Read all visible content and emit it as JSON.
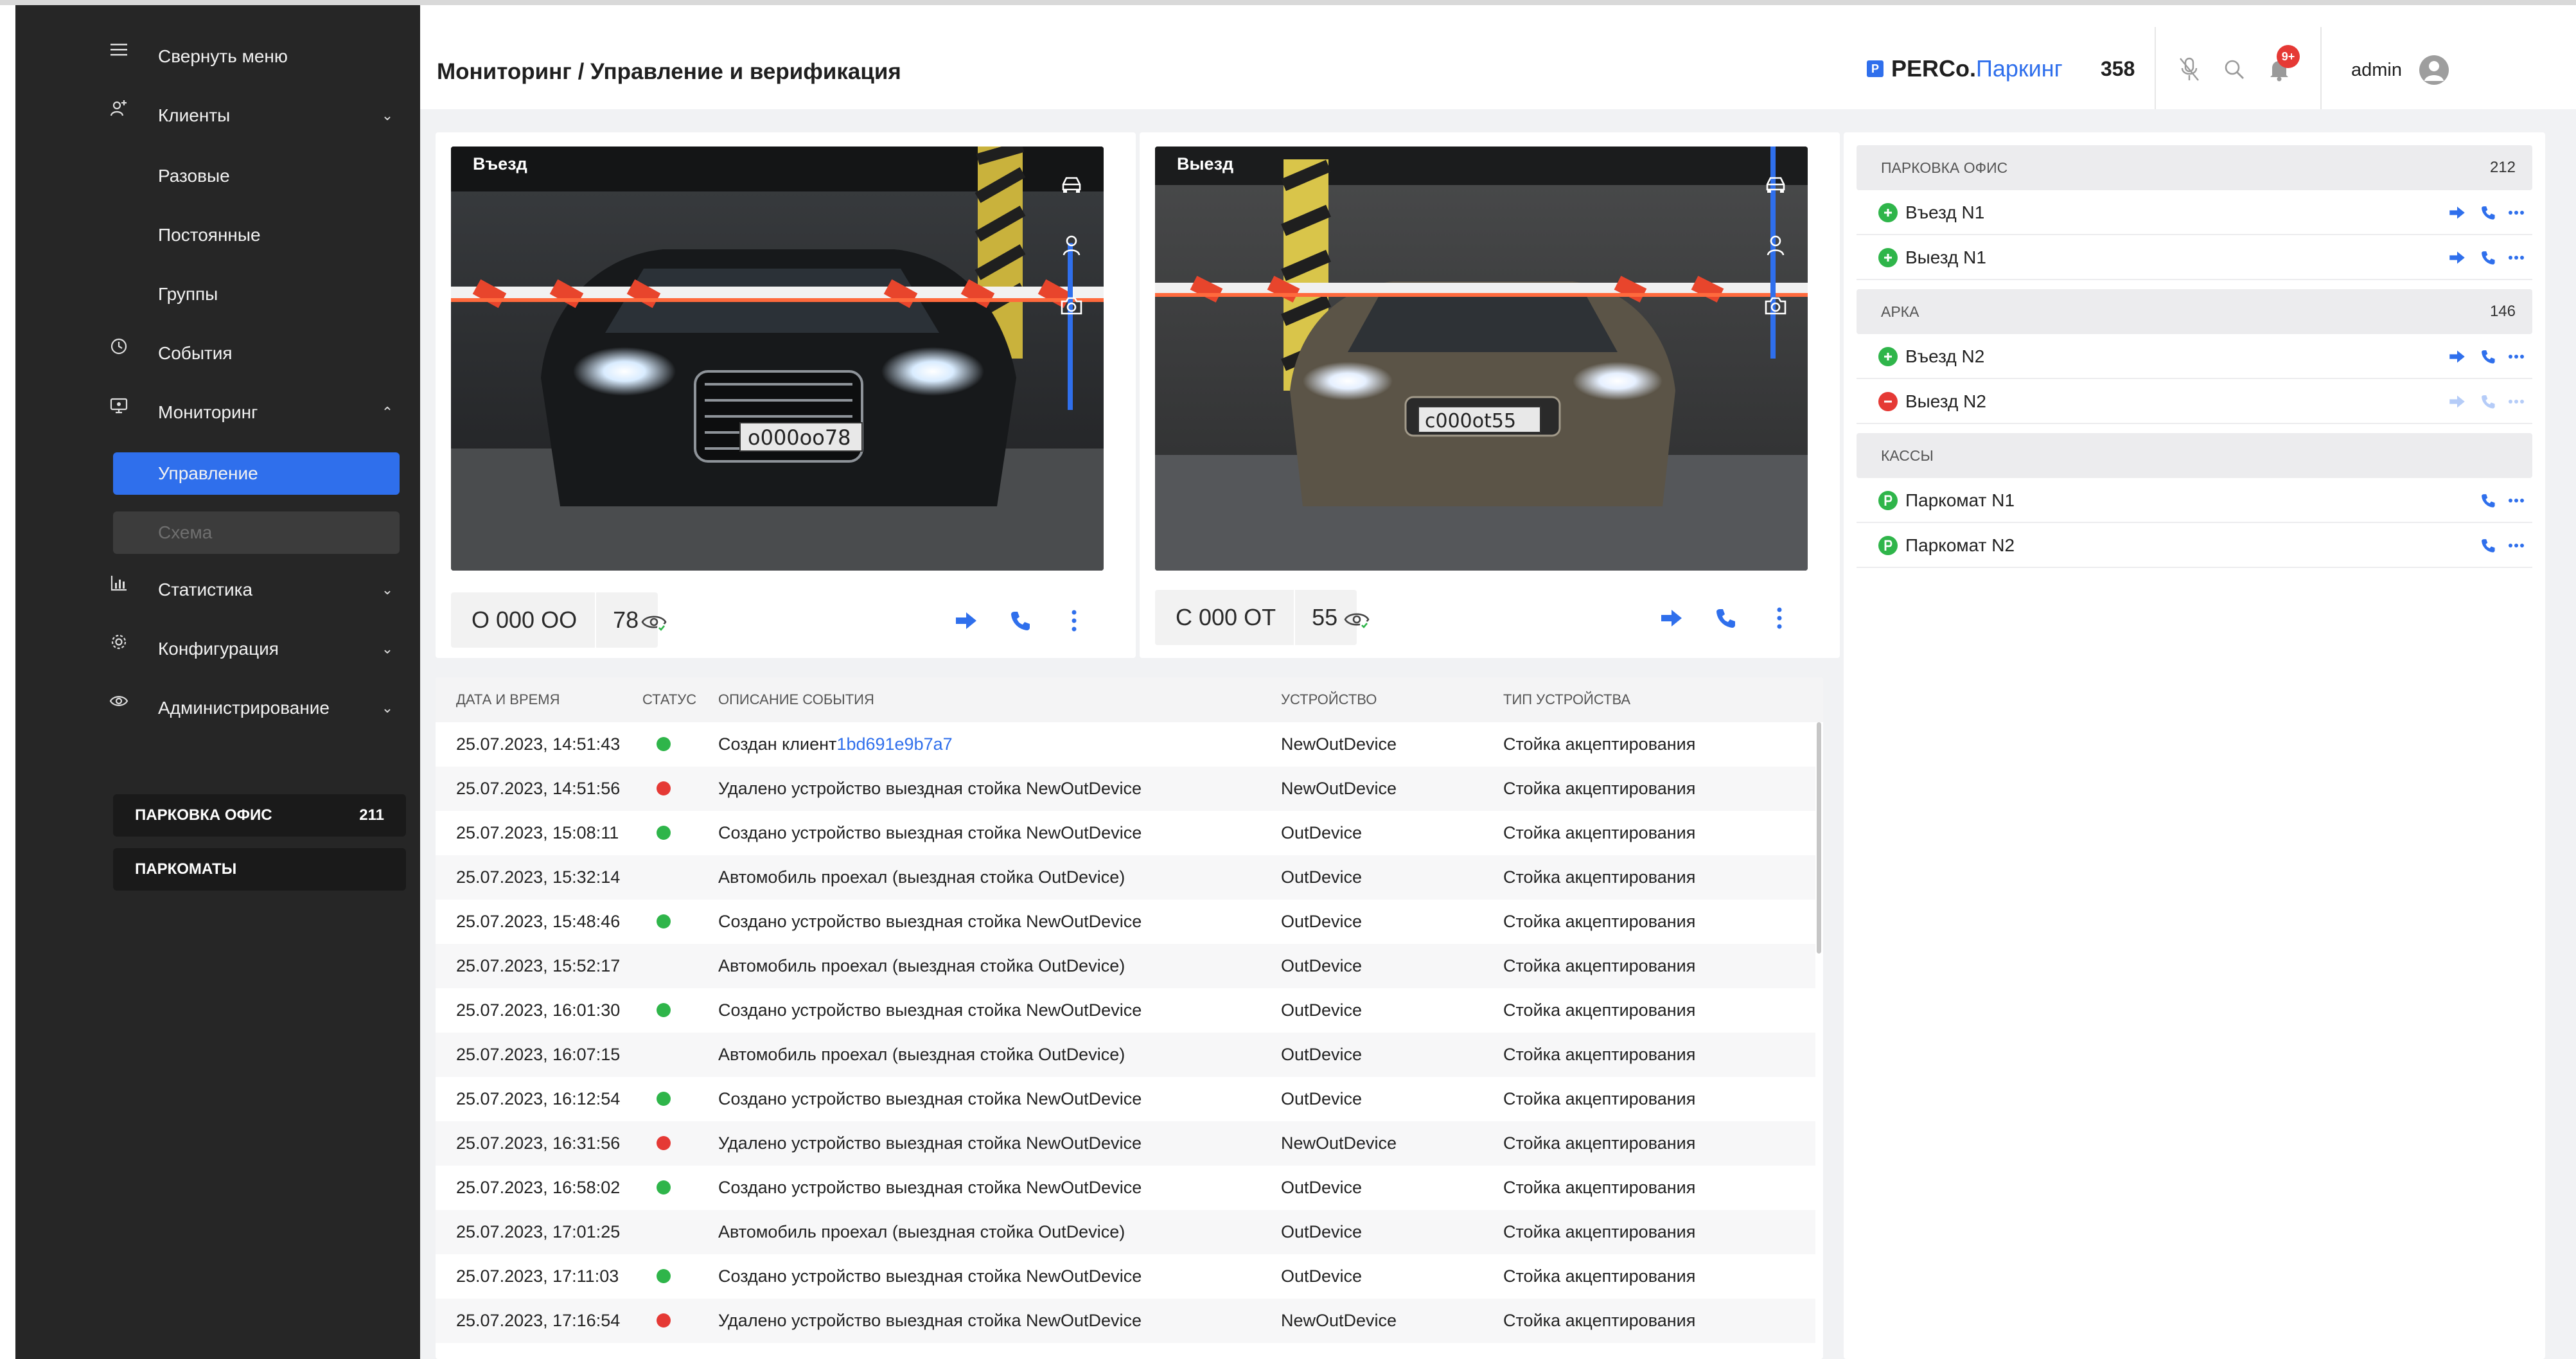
{
  "sidebar": {
    "collapse_label": "Свернуть меню",
    "items": [
      {
        "label": "Клиенты",
        "icon": "clients-icon"
      },
      {
        "label": "Разовые"
      },
      {
        "label": "Постоянные"
      },
      {
        "label": "Группы"
      },
      {
        "label": "События",
        "icon": "clock-icon"
      },
      {
        "label": "Мониторинг",
        "icon": "monitor-icon"
      },
      {
        "label": "Управление"
      },
      {
        "label": "Схема"
      },
      {
        "label": "Статистика",
        "icon": "chart-icon"
      },
      {
        "label": "Конфигурация",
        "icon": "gear-icon"
      },
      {
        "label": "Администрирование",
        "icon": "eye-icon"
      }
    ],
    "parkings": [
      {
        "name": "ПАРКОВКА ОФИС",
        "count": "211"
      },
      {
        "name": "ПАРКОМАТЫ",
        "count": ""
      }
    ]
  },
  "header": {
    "title": "Мониторинг / Управление и верификация",
    "logo_mark": "P",
    "logo_brand": "PERCo.",
    "logo_product": "Паркинг",
    "count": "358",
    "notifications_badge": "9+",
    "user": "admin"
  },
  "cameras": [
    {
      "label": "Въезд",
      "plate_number": "О 000 ОО",
      "plate_region": "78"
    },
    {
      "label": "Выезд",
      "plate_number": "С 000 ОТ",
      "plate_region": "55"
    }
  ],
  "events": {
    "columns": [
      "ДАТА И ВРЕМЯ",
      "СТАТУС",
      "ОПИСАНИЕ СОБЫТИЯ",
      "УСТРОЙСТВО",
      "ТИП УСТРОЙСТВА"
    ],
    "rows": [
      {
        "time": "25.07.2023, 14:51:43",
        "status": "green",
        "desc": "Создан клиент ",
        "link": "1bd691e9b7a7",
        "device": "NewOutDevice",
        "type": "Стойка акцептирования"
      },
      {
        "time": "25.07.2023, 14:51:56",
        "status": "red",
        "desc": "Удалено устройство выездная стойка NewOutDevice",
        "link": "",
        "device": "NewOutDevice",
        "type": "Стойка акцептирования"
      },
      {
        "time": "25.07.2023, 15:08:11",
        "status": "green",
        "desc": "Создано устройство выездная стойка NewOutDevice",
        "link": "",
        "device": "OutDevice",
        "type": "Стойка акцептирования"
      },
      {
        "time": "25.07.2023, 15:32:14",
        "status": "none",
        "desc": "Автомобиль проехал (выездная стойка OutDevice)",
        "link": "",
        "device": "OutDevice",
        "type": "Стойка акцептирования"
      },
      {
        "time": "25.07.2023, 15:48:46",
        "status": "green",
        "desc": "Создано устройство выездная стойка NewOutDevice",
        "link": "",
        "device": "OutDevice",
        "type": "Стойка акцептирования"
      },
      {
        "time": "25.07.2023, 15:52:17",
        "status": "none",
        "desc": "Автомобиль проехал (выездная стойка OutDevice)",
        "link": "",
        "device": "OutDevice",
        "type": "Стойка акцептирования"
      },
      {
        "time": "25.07.2023, 16:01:30",
        "status": "green",
        "desc": "Создано устройство выездная стойка NewOutDevice",
        "link": "",
        "device": "OutDevice",
        "type": "Стойка акцептирования"
      },
      {
        "time": "25.07.2023, 16:07:15",
        "status": "none",
        "desc": "Автомобиль проехал (выездная стойка OutDevice)",
        "link": "",
        "device": "OutDevice",
        "type": "Стойка акцептирования"
      },
      {
        "time": "25.07.2023, 16:12:54",
        "status": "green",
        "desc": "Создано устройство выездная стойка NewOutDevice",
        "link": "",
        "device": "OutDevice",
        "type": "Стойка акцептирования"
      },
      {
        "time": "25.07.2023, 16:31:56",
        "status": "red",
        "desc": "Удалено устройство выездная стойка NewOutDevice",
        "link": "",
        "device": "NewOutDevice",
        "type": "Стойка акцептирования"
      },
      {
        "time": "25.07.2023, 16:58:02",
        "status": "green",
        "desc": "Создано устройство выездная стойка NewOutDevice",
        "link": "",
        "device": "OutDevice",
        "type": "Стойка акцептирования"
      },
      {
        "time": "25.07.2023, 17:01:25",
        "status": "none",
        "desc": "Автомобиль проехал (выездная стойка OutDevice)",
        "link": "",
        "device": "OutDevice",
        "type": "Стойка акцептирования"
      },
      {
        "time": "25.07.2023, 17:11:03",
        "status": "green",
        "desc": "Создано устройство выездная стойка NewOutDevice",
        "link": "",
        "device": "OutDevice",
        "type": "Стойка акцептирования"
      },
      {
        "time": "25.07.2023, 17:16:54",
        "status": "red",
        "desc": "Удалено устройство выездная стойка NewOutDevice",
        "link": "",
        "device": "NewOutDevice",
        "type": "Стойка акцептирования"
      }
    ]
  },
  "device_groups": [
    {
      "name": "ПАРКОВКА ОФИС",
      "count": "212",
      "devices": [
        {
          "name": "Въезд N1",
          "state": "online",
          "kind": "gate"
        },
        {
          "name": "Выезд N1",
          "state": "online",
          "kind": "gate"
        }
      ]
    },
    {
      "name": "АРКА",
      "count": "146",
      "devices": [
        {
          "name": "Въезд N2",
          "state": "online",
          "kind": "gate"
        },
        {
          "name": "Выезд N2",
          "state": "error",
          "kind": "gate"
        }
      ]
    },
    {
      "name": "КАССЫ",
      "count": "",
      "devices": [
        {
          "name": "Паркомат N1",
          "state": "online",
          "kind": "kiosk"
        },
        {
          "name": "Паркомат N2",
          "state": "online",
          "kind": "kiosk"
        }
      ]
    }
  ],
  "colors": {
    "accent": "#2f6fec",
    "green": "#2fb54a",
    "red": "#e53935",
    "sidebar": "#262626"
  }
}
